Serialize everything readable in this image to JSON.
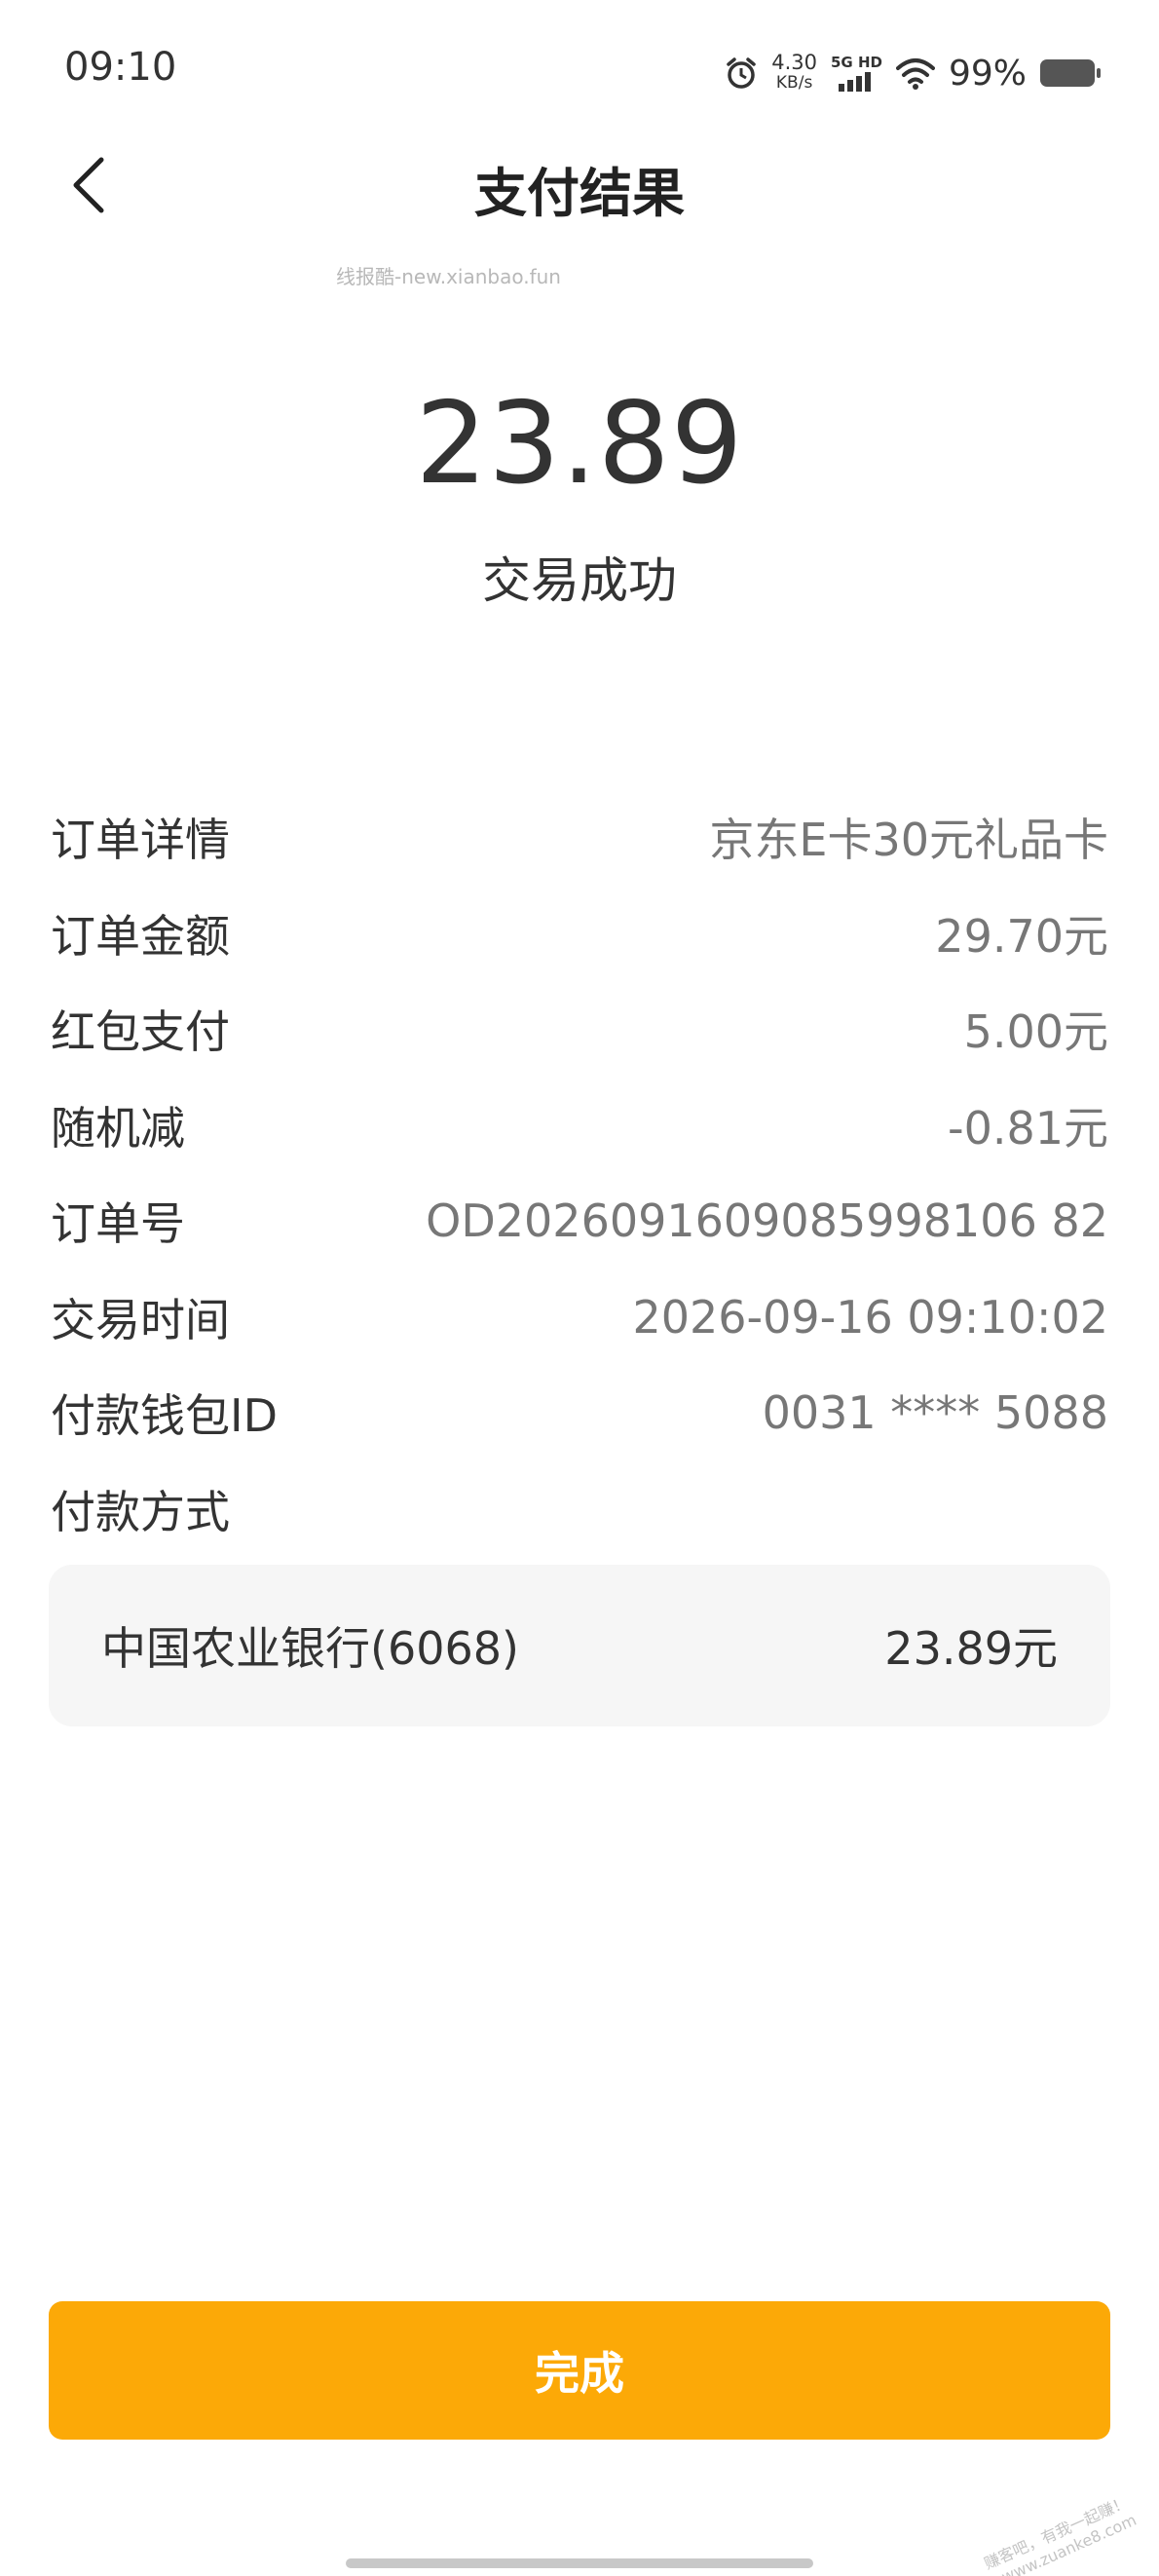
{
  "status_bar": {
    "time": "09:10",
    "net_speed": "4.30",
    "net_unit": "KB/s",
    "signal_label": "5G HD",
    "battery_percent": "99%",
    "icons": [
      "alarm-icon",
      "signal-icon",
      "wifi-icon",
      "battery-icon"
    ]
  },
  "header": {
    "title": "支付结果",
    "back_icon": "chevron-left-icon"
  },
  "watermark": "线报酷-new.xianbao.fun",
  "summary": {
    "amount": "23.89",
    "status": "交易成功"
  },
  "details": [
    {
      "label": "订单详情",
      "value": "京东E卡30元礼品卡"
    },
    {
      "label": "订单金额",
      "value": "29.70元"
    },
    {
      "label": "红包支付",
      "value": "5.00元"
    },
    {
      "label": "随机减",
      "value": "-0.81元"
    },
    {
      "label": "订单号",
      "value": "OD2026091609085998106 82"
    },
    {
      "label": "交易时间",
      "value": "2026-09-16 09:10:02"
    },
    {
      "label": "付款钱包ID",
      "value": "0031 **** 5088"
    },
    {
      "label": "付款方式",
      "value": ""
    }
  ],
  "payment": {
    "bank": "中国农业银行(6068)",
    "amount": "23.89元"
  },
  "done_button": "完成",
  "stamp": {
    "line1": "赚客吧，有我一起赚！",
    "line2": "www.zuanke8.com"
  },
  "colors": {
    "accent": "#fca907",
    "card_bg": "#f6f6f6",
    "text": "#333333",
    "muted": "#777777"
  }
}
